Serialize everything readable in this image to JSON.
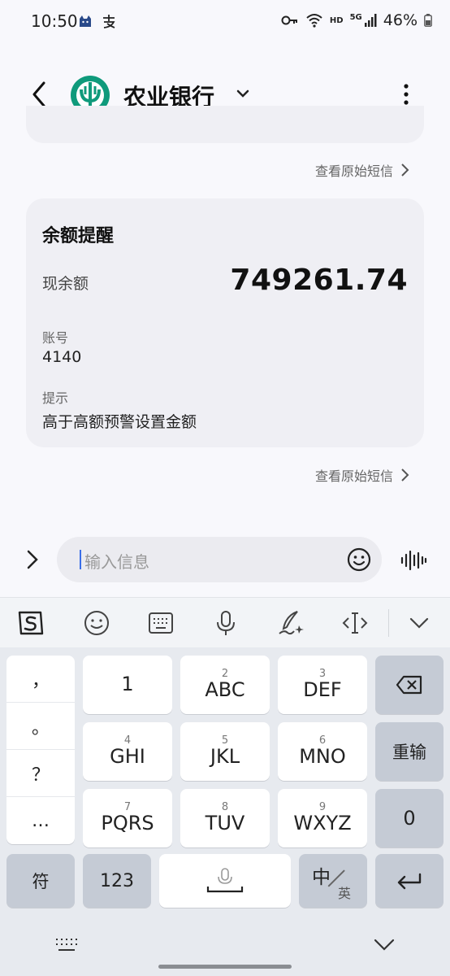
{
  "status_bar": {
    "time": "10:50",
    "battery": "46%",
    "net_hd": "HD",
    "net_5g": "5G"
  },
  "header": {
    "title": "农业银行"
  },
  "messages": {
    "view_original": "查看原始短信",
    "card": {
      "title": "余额提醒",
      "balance_label": "现余额",
      "balance_value": "749261.74",
      "account_label": "账号",
      "account_value": "4140",
      "tip_label": "提示",
      "tip_value": "高于高额预警设置金额"
    }
  },
  "composer": {
    "placeholder": "输入信息"
  },
  "keyboard": {
    "punct": [
      "，",
      "。",
      "？",
      "…"
    ],
    "keys": [
      {
        "num": "",
        "letters": "1"
      },
      {
        "num": "2",
        "letters": "ABC"
      },
      {
        "num": "3",
        "letters": "DEF"
      },
      {
        "num": "4",
        "letters": "GHI"
      },
      {
        "num": "5",
        "letters": "JKL"
      },
      {
        "num": "6",
        "letters": "MNO"
      },
      {
        "num": "7",
        "letters": "PQRS"
      },
      {
        "num": "8",
        "letters": "TUV"
      },
      {
        "num": "9",
        "letters": "WXYZ"
      }
    ],
    "reenter": "重输",
    "zero": "0",
    "symbols": "符",
    "num_mode": "123",
    "lang_main": "中",
    "lang_alt": "英"
  },
  "colors": {
    "accent": "#3a6ee8",
    "bank_green": "#0f9a7b",
    "card_bg": "#efeff4"
  }
}
